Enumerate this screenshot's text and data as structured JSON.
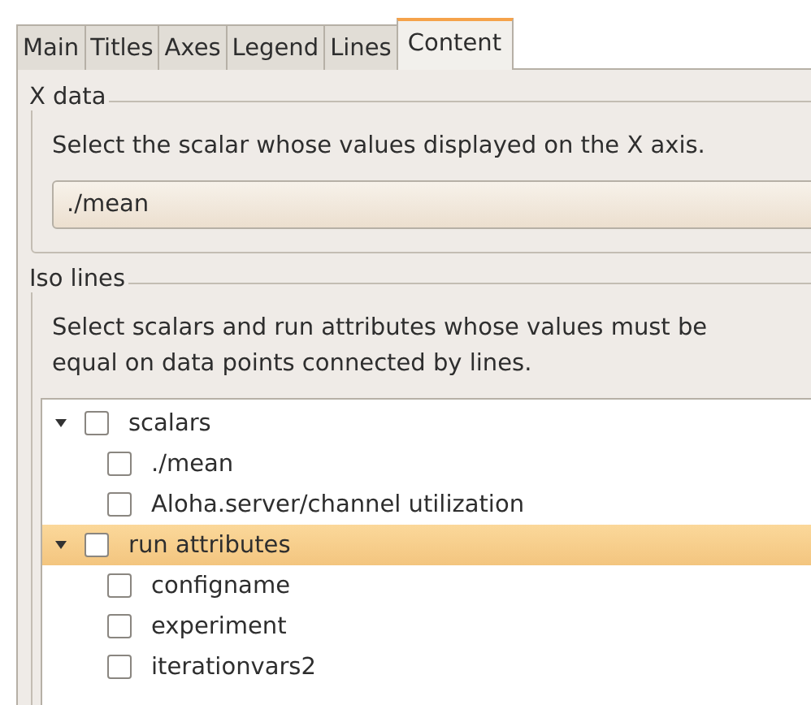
{
  "tabs": [
    {
      "label": "Main",
      "selected": false
    },
    {
      "label": "Titles",
      "selected": false
    },
    {
      "label": "Axes",
      "selected": false
    },
    {
      "label": "Legend",
      "selected": false
    },
    {
      "label": "Lines",
      "selected": false
    },
    {
      "label": "Content",
      "selected": true
    }
  ],
  "x_data": {
    "title": "X data",
    "description": "Select the scalar whose values displayed on the X axis.",
    "combo": {
      "value": "./mean"
    }
  },
  "iso_lines": {
    "title": "Iso lines",
    "description": "Select scalars and run attributes whose values must be equal on data points connected by lines.",
    "tree": [
      {
        "label": "scalars",
        "expanded": true,
        "checked": false,
        "selected": false,
        "children": [
          {
            "label": "./mean",
            "checked": false,
            "selected": false
          },
          {
            "label": "Aloha.server/channel utilization",
            "checked": false,
            "selected": false
          }
        ]
      },
      {
        "label": "run attributes",
        "expanded": true,
        "checked": false,
        "selected": true,
        "children": [
          {
            "label": "configname",
            "checked": false,
            "selected": false
          },
          {
            "label": "experiment",
            "checked": false,
            "selected": false
          },
          {
            "label": "iterationvars2",
            "checked": false,
            "selected": false
          }
        ]
      }
    ]
  }
}
